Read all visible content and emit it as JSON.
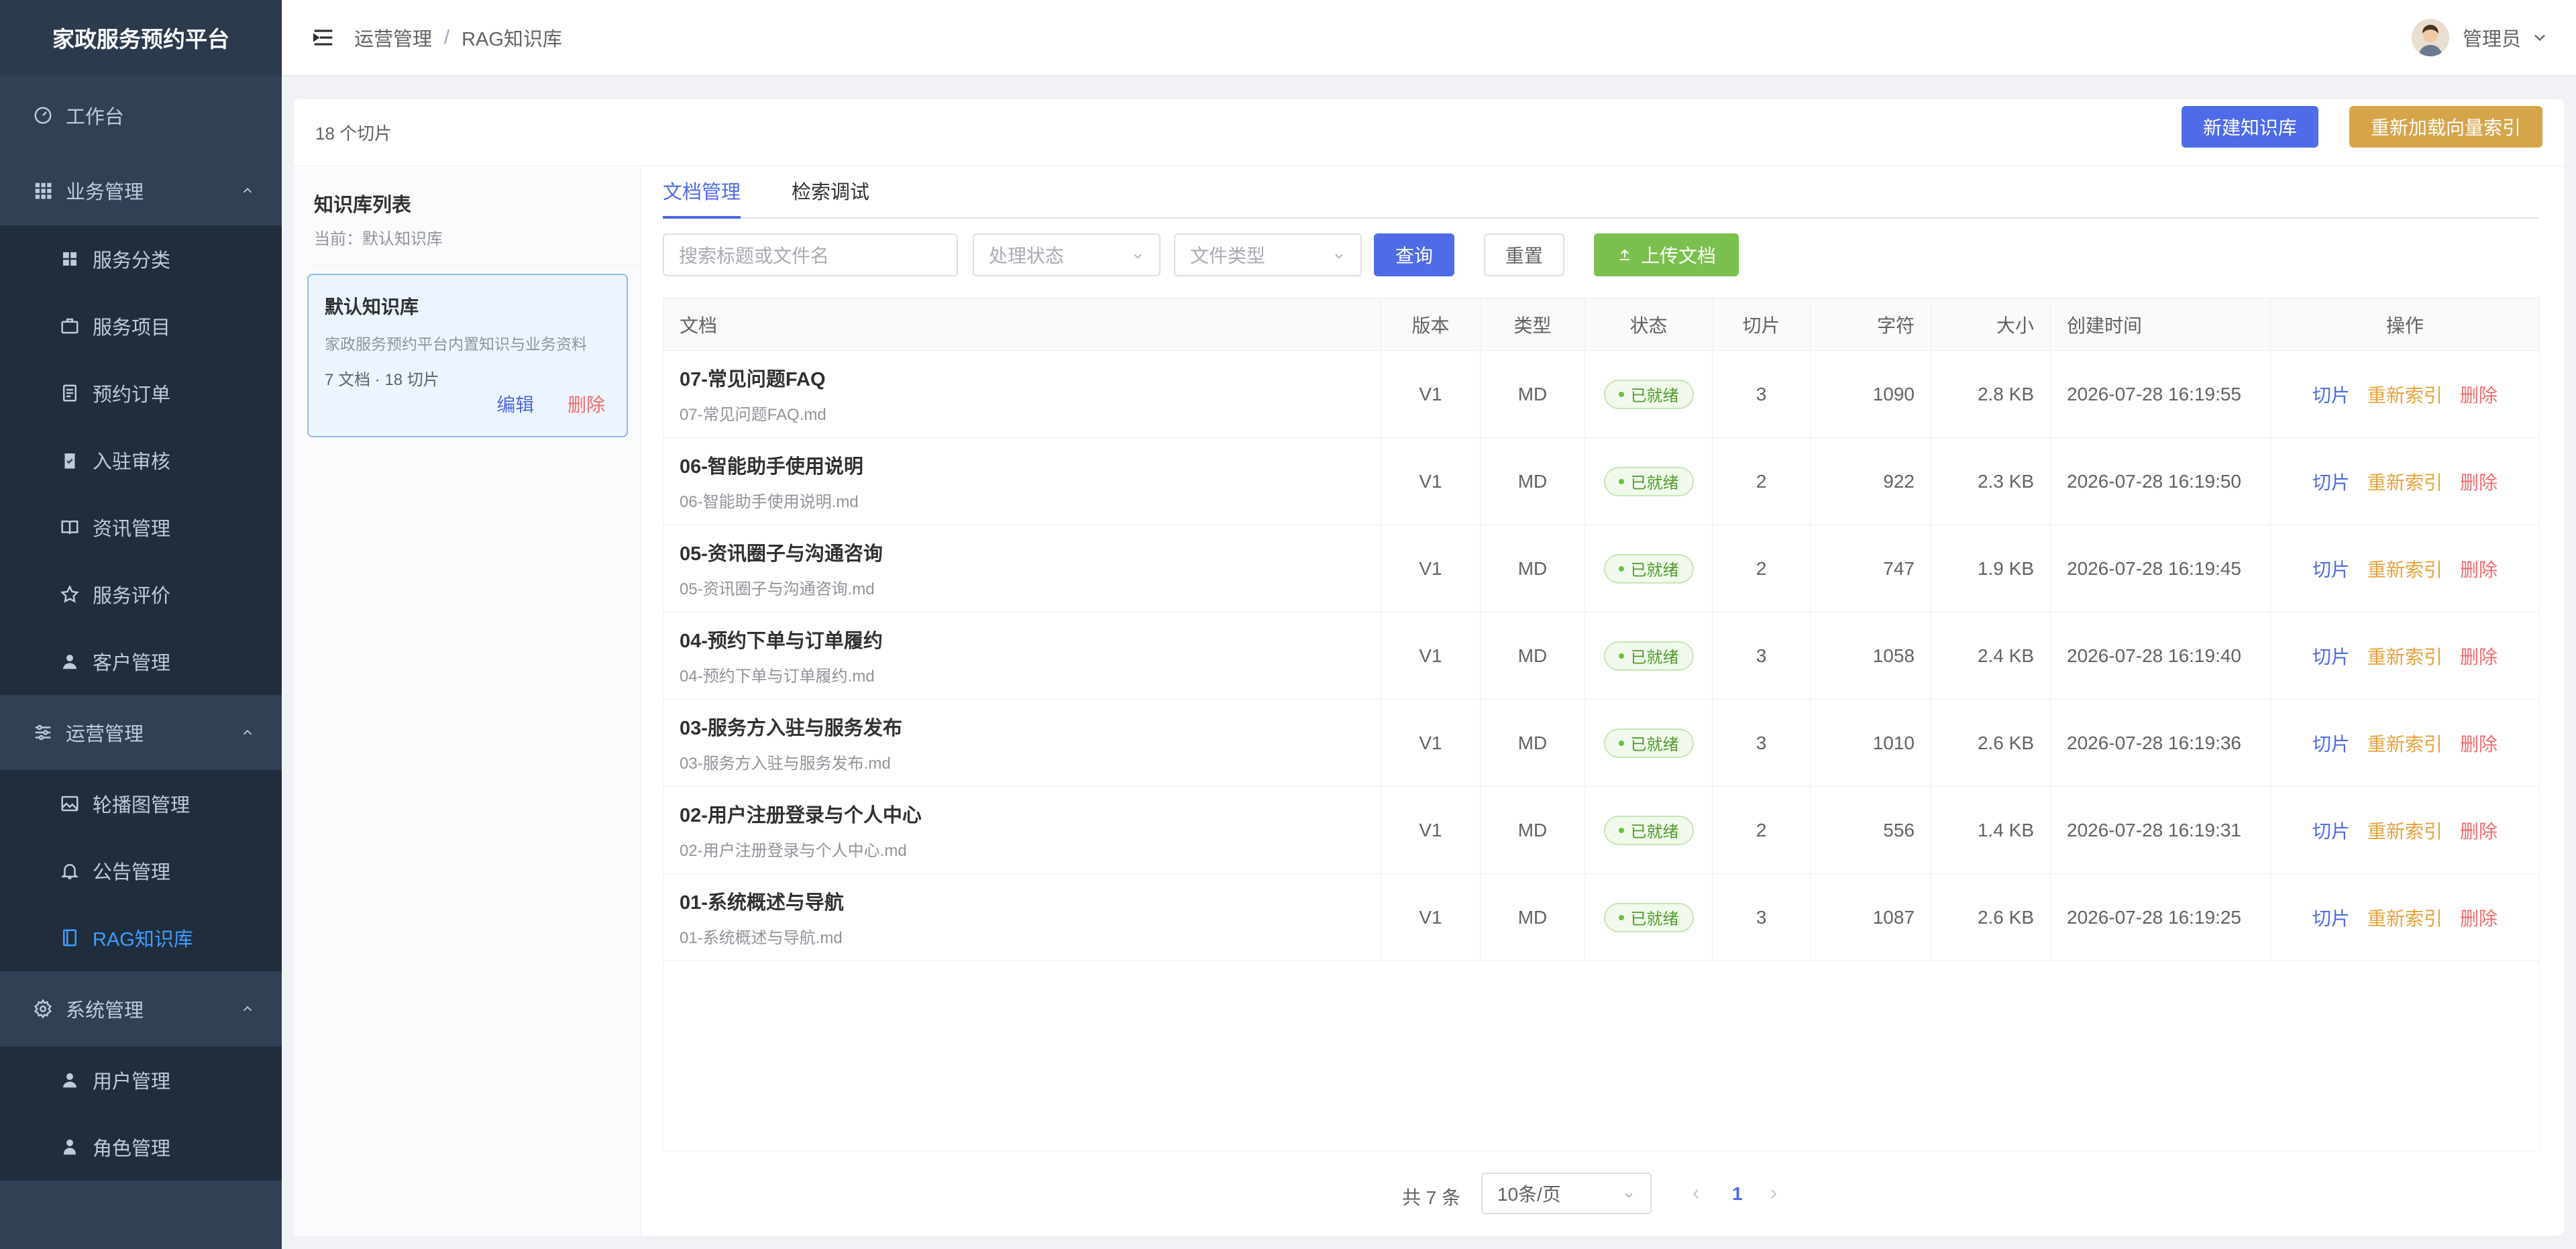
{
  "sidebar": {
    "brand": "家政服务预约平台",
    "items": [
      {
        "label": "工作台",
        "icon": "dashboard-icon"
      },
      {
        "label": "业务管理",
        "icon": "grid-icon"
      },
      {
        "label": "服务分类",
        "icon": "category-icon"
      },
      {
        "label": "服务项目",
        "icon": "briefcase-icon"
      },
      {
        "label": "预约订单",
        "icon": "document-icon"
      },
      {
        "label": "入驻审核",
        "icon": "clipboard-check-icon"
      },
      {
        "label": "资讯管理",
        "icon": "book-icon"
      },
      {
        "label": "服务评价",
        "icon": "star-icon"
      },
      {
        "label": "客户管理",
        "icon": "user-icon"
      },
      {
        "label": "运营管理",
        "icon": "sliders-icon"
      },
      {
        "label": "轮播图管理",
        "icon": "image-icon"
      },
      {
        "label": "公告管理",
        "icon": "bell-icon"
      },
      {
        "label": "RAG知识库",
        "icon": "notebook-icon"
      },
      {
        "label": "系统管理",
        "icon": "settings-icon"
      },
      {
        "label": "用户管理",
        "icon": "user-icon"
      },
      {
        "label": "角色管理",
        "icon": "user-badge-icon"
      }
    ]
  },
  "header": {
    "breadcrumb": [
      "运营管理",
      "RAG知识库"
    ],
    "user": "管理员"
  },
  "toolbar": {
    "summary": "18 个切片",
    "new_kb": "新建知识库",
    "reload_index": "重新加载向量索引"
  },
  "kb_panel": {
    "title": "知识库列表",
    "current": "当前：默认知识库",
    "card": {
      "name": "默认知识库",
      "desc": "家政服务预约平台内置知识与业务资料",
      "stats": "7 文档 · 18 切片",
      "edit": "编辑",
      "delete": "删除"
    }
  },
  "tabs": [
    "文档管理",
    "检索调试"
  ],
  "filters": {
    "search_placeholder": "搜索标题或文件名",
    "status_placeholder": "处理状态",
    "type_placeholder": "文件类型",
    "query": "查询",
    "reset": "重置",
    "upload": "上传文档"
  },
  "table": {
    "columns": [
      "文档",
      "版本",
      "类型",
      "状态",
      "切片",
      "字符",
      "大小",
      "创建时间",
      "操作"
    ],
    "rows": [
      {
        "title": "07-常见问题FAQ",
        "file": "07-常见问题FAQ.md",
        "version": "V1",
        "type": "MD",
        "status": "已就绪",
        "chunks": "3",
        "chars": "1090",
        "size": "2.8 KB",
        "created": "2026-07-28 16:19:55"
      },
      {
        "title": "06-智能助手使用说明",
        "file": "06-智能助手使用说明.md",
        "version": "V1",
        "type": "MD",
        "status": "已就绪",
        "chunks": "2",
        "chars": "922",
        "size": "2.3 KB",
        "created": "2026-07-28 16:19:50"
      },
      {
        "title": "05-资讯圈子与沟通咨询",
        "file": "05-资讯圈子与沟通咨询.md",
        "version": "V1",
        "type": "MD",
        "status": "已就绪",
        "chunks": "2",
        "chars": "747",
        "size": "1.9 KB",
        "created": "2026-07-28 16:19:45"
      },
      {
        "title": "04-预约下单与订单履约",
        "file": "04-预约下单与订单履约.md",
        "version": "V1",
        "type": "MD",
        "status": "已就绪",
        "chunks": "3",
        "chars": "1058",
        "size": "2.4 KB",
        "created": "2026-07-28 16:19:40"
      },
      {
        "title": "03-服务方入驻与服务发布",
        "file": "03-服务方入驻与服务发布.md",
        "version": "V1",
        "type": "MD",
        "status": "已就绪",
        "chunks": "3",
        "chars": "1010",
        "size": "2.6 KB",
        "created": "2026-07-28 16:19:36"
      },
      {
        "title": "02-用户注册登录与个人中心",
        "file": "02-用户注册登录与个人中心.md",
        "version": "V1",
        "type": "MD",
        "status": "已就绪",
        "chunks": "2",
        "chars": "556",
        "size": "1.4 KB",
        "created": "2026-07-28 16:19:31"
      },
      {
        "title": "01-系统概述与导航",
        "file": "01-系统概述与导航.md",
        "version": "V1",
        "type": "MD",
        "status": "已就绪",
        "chunks": "3",
        "chars": "1087",
        "size": "2.6 KB",
        "created": "2026-07-28 16:19:25"
      }
    ],
    "actions": {
      "chunks": "切片",
      "reindex": "重新索引",
      "delete": "删除"
    }
  },
  "pagination": {
    "total": "共 7 条",
    "page_size": "10条/页",
    "current_page": "1"
  },
  "colors": {
    "sidebar_bg": "#304156",
    "active_menu": "#409eff",
    "primary": "#4f6be8",
    "warning": "#d6a54a",
    "success": "#7bc04f",
    "danger": "#f56c6c"
  }
}
